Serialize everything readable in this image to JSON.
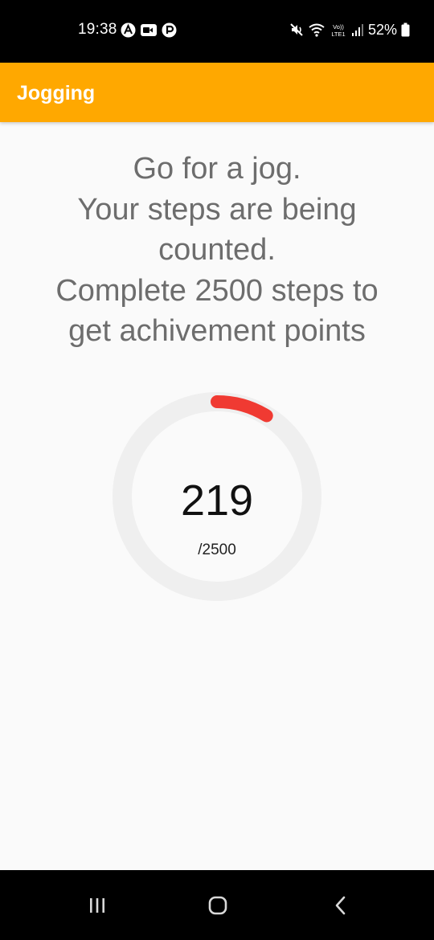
{
  "status_bar": {
    "time": "19:38",
    "battery": "52%"
  },
  "app_bar": {
    "title": "Jogging"
  },
  "main": {
    "instruction_lines": [
      "Go for a jog.",
      "Your steps are being",
      "counted.",
      "Complete 2500 steps to",
      "get achivement points"
    ],
    "steps": "219",
    "goal_label": "/2500",
    "progress_fraction": 0.0876
  },
  "colors": {
    "app_bar": "#ffa800",
    "progress": "#f03a32",
    "track": "#efefef"
  },
  "nav_bar": {
    "buttons": [
      "recent-apps-icon",
      "home-icon",
      "back-icon"
    ]
  }
}
